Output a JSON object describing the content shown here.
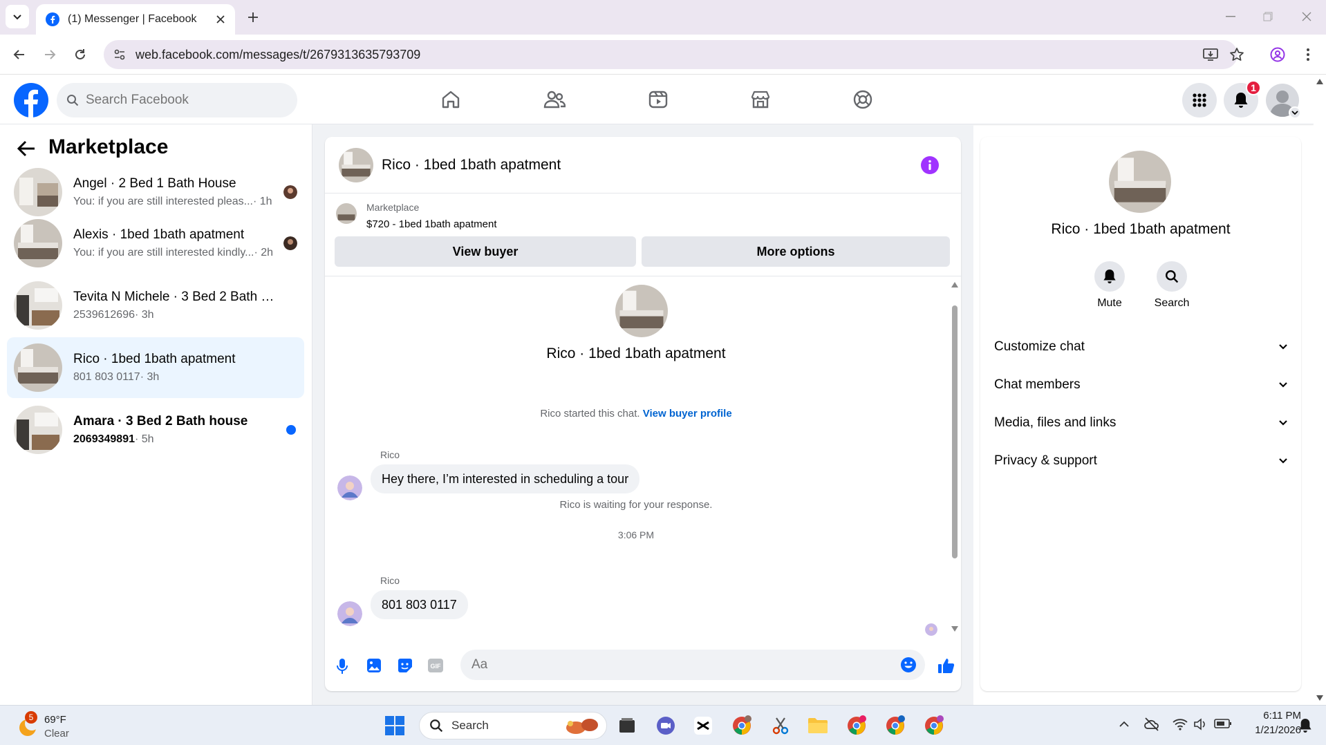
{
  "browser": {
    "tab_title": "(1) Messenger | Facebook",
    "url": "web.facebook.com/messages/t/2679313635793709"
  },
  "fb_header": {
    "search_placeholder": "Search Facebook",
    "notification_count": "1"
  },
  "left_panel": {
    "title": "Marketplace",
    "conversations": [
      {
        "name": "Angel · 2 Bed 1 Bath House",
        "preview": "You: if you are still interested pleas...",
        "time": "· 1h",
        "selected": false,
        "unread": false
      },
      {
        "name": "Alexis · 1bed 1bath apatment",
        "preview": "You: if you are still interested kindly...",
        "time": "· 2h",
        "selected": false,
        "unread": false
      },
      {
        "name": "Tevita N Michele · 3 Bed 2 Bath ho...",
        "preview": "2539612696",
        "time": "· 3h",
        "selected": false,
        "unread": false
      },
      {
        "name": "Rico · 1bed 1bath apatment",
        "preview": "801 803 0117",
        "time": "· 3h",
        "selected": true,
        "unread": false
      },
      {
        "name": "Amara · 3 Bed 2 Bath house",
        "preview": "2069349891",
        "time": "· 5h",
        "selected": false,
        "unread": true
      }
    ]
  },
  "chat": {
    "title": "Rico · 1bed 1bath apatment",
    "marketplace_label": "Marketplace",
    "listing": "$720 - 1bed 1bath apatment",
    "view_buyer": "View buyer",
    "more_options": "More options",
    "intro_name": "Rico · 1bed 1bath apatment",
    "started_text": "Rico started this chat.",
    "view_buyer_profile": "View buyer profile",
    "messages": [
      {
        "sender": "Rico",
        "text": "Hey there, I’m interested in scheduling a tour"
      },
      {
        "sender": "Rico",
        "text": "801 803 0117"
      }
    ],
    "waiting_text": "Rico is waiting for your response.",
    "timestamp": "3:06 PM",
    "composer_placeholder": "Aa"
  },
  "right_panel": {
    "name": "Rico · 1bed 1bath apatment",
    "mute_label": "Mute",
    "search_label": "Search",
    "sections": [
      "Customize chat",
      "Chat members",
      "Media, files and links",
      "Privacy & support"
    ]
  },
  "taskbar": {
    "weather_temp": "69°F",
    "weather_desc": "Clear",
    "weather_badge": "5",
    "search_label": "Search",
    "time": "6:11 PM",
    "date": "1/21/2026"
  },
  "colors": {
    "facebook_blue": "#0866ff",
    "selected_bg": "#ebf5ff",
    "info_purple": "#a033ff"
  }
}
